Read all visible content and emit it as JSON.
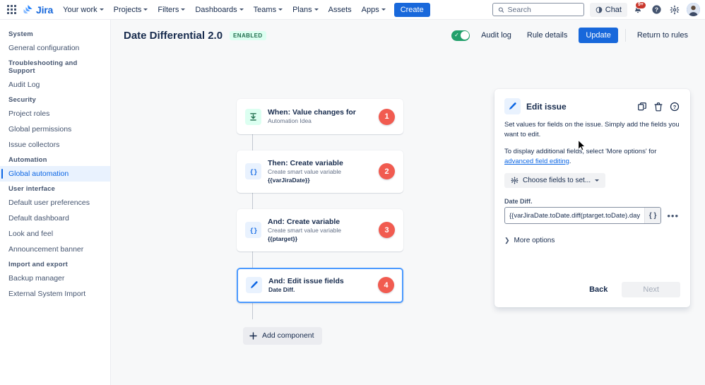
{
  "topnav": {
    "app_switcher": "app-switcher",
    "brand": "Jira",
    "items": [
      {
        "label": "Your work",
        "caret": true
      },
      {
        "label": "Projects",
        "caret": true
      },
      {
        "label": "Filters",
        "caret": true
      },
      {
        "label": "Dashboards",
        "caret": true
      },
      {
        "label": "Teams",
        "caret": true
      },
      {
        "label": "Plans",
        "caret": true
      },
      {
        "label": "Assets",
        "caret": false
      },
      {
        "label": "Apps",
        "caret": true
      }
    ],
    "create_label": "Create",
    "search_placeholder": "Search",
    "search_value": "",
    "chat_label": "Chat",
    "notification_count": "9+"
  },
  "sidebar": {
    "groups": [
      {
        "title": "System",
        "items": [
          {
            "label": "General configuration",
            "active": false
          }
        ]
      },
      {
        "title": "Troubleshooting and Support",
        "items": [
          {
            "label": "Audit Log",
            "active": false
          }
        ]
      },
      {
        "title": "Security",
        "items": [
          {
            "label": "Project roles",
            "active": false
          },
          {
            "label": "Global permissions",
            "active": false
          },
          {
            "label": "Issue collectors",
            "active": false
          }
        ]
      },
      {
        "title": "Automation",
        "items": [
          {
            "label": "Global automation",
            "active": true
          }
        ]
      },
      {
        "title": "User interface",
        "items": [
          {
            "label": "Default user preferences",
            "active": false
          },
          {
            "label": "Default dashboard",
            "active": false
          },
          {
            "label": "Look and feel",
            "active": false
          },
          {
            "label": "Announcement banner",
            "active": false
          }
        ]
      },
      {
        "title": "Import and export",
        "items": [
          {
            "label": "Backup manager",
            "active": false
          },
          {
            "label": "External System Import",
            "active": false
          }
        ]
      }
    ]
  },
  "rule_header": {
    "title": "Date Differential 2.0",
    "status_badge": "ENABLED",
    "toggle_on": true,
    "audit_log_label": "Audit log",
    "rule_details_label": "Rule details",
    "update_label": "Update",
    "return_label": "Return to rules"
  },
  "rule_chain": {
    "nodes": [
      {
        "title": "When: Value changes for",
        "subtitle": "Automation Idea",
        "smart_value": "",
        "badge": "1",
        "icon": "value-changes-icon",
        "icon_color": "green",
        "selected": false
      },
      {
        "title": "Then: Create variable",
        "subtitle": "Create smart value variable",
        "smart_value": "{{varJiraDate}}",
        "badge": "2",
        "icon": "braces-icon",
        "icon_color": "blue",
        "selected": false
      },
      {
        "title": "And: Create variable",
        "subtitle": "Create smart value variable",
        "smart_value": "{{ptarget}}",
        "badge": "3",
        "icon": "braces-icon",
        "icon_color": "blue",
        "selected": false
      },
      {
        "title": "And: Edit issue fields",
        "subtitle": "Date Diff.",
        "smart_value": "",
        "badge": "4",
        "icon": "pencil-icon",
        "icon_color": "blue",
        "selected": true
      }
    ],
    "add_component_label": "Add component"
  },
  "panel": {
    "title": "Edit issue",
    "icon": "pencil-icon",
    "actions": [
      "copy-icon",
      "trash-icon",
      "help-icon"
    ],
    "description_1": "Set values for fields on the issue. Simply add the fields you want to edit.",
    "description_2_prefix": "To display additional fields, select 'More options' for ",
    "description_2_link": "advanced field editing",
    "description_2_suffix": ".",
    "choose_fields_label": "Choose fields to set...",
    "field_label": "Date Diff.",
    "field_value": "{{varJiraDate.toDate.diff(ptarget.toDate).days",
    "smart_value_button": "{ }",
    "more_menu": "•••",
    "more_options_label": "More options",
    "back_label": "Back",
    "next_label": "Next"
  },
  "colors": {
    "brand_blue": "#1868DB",
    "primary_button": "#1868DB",
    "badge_red": "#F15B50",
    "enabled_green_bg": "#DCFFF1",
    "enabled_green_text": "#216E4E",
    "toggle_green": "#22A06B",
    "selected_border": "#4C9AFF",
    "sidebar_active_bg": "#E9F2FE",
    "canvas_bg": "#F7F8F9"
  }
}
